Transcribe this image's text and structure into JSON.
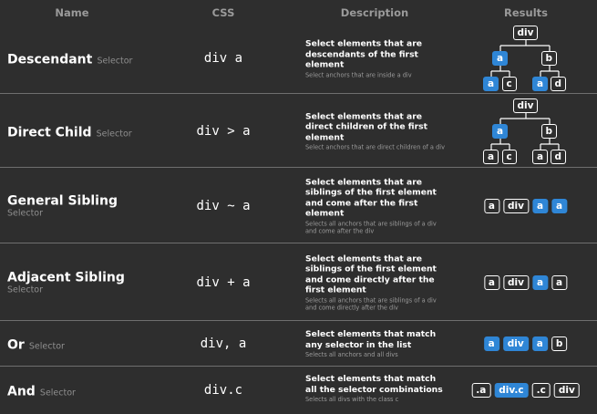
{
  "header": {
    "name": "Name",
    "css": "CSS",
    "description": "Description",
    "results": "Results"
  },
  "colors": {
    "background": "#2e2e2e",
    "highlight": "#2f86d6",
    "divider": "#6f6f6f",
    "muted": "#9a9a9a"
  },
  "rows": [
    {
      "name": "Descendant",
      "suffix": "Selector",
      "css": "div a",
      "desc": "Select elements that are descendants of the first element",
      "note": "Select anchors that are inside a div",
      "tree": {
        "root": "div",
        "l1": [
          {
            "t": "a",
            "hl": true
          },
          {
            "t": "b",
            "hl": false
          }
        ],
        "l2": [
          {
            "t": "a",
            "hl": true
          },
          {
            "t": "c",
            "hl": false
          },
          {
            "t": "a",
            "hl": true
          },
          {
            "t": "d",
            "hl": false
          }
        ]
      }
    },
    {
      "name": "Direct Child",
      "suffix": "Selector",
      "css": "div > a",
      "desc": "Select elements that are direct children of the first element",
      "note": "Select anchors that are direct children of a div",
      "tree": {
        "root": "div",
        "l1": [
          {
            "t": "a",
            "hl": true
          },
          {
            "t": "b",
            "hl": false
          }
        ],
        "l2": [
          {
            "t": "a",
            "hl": false
          },
          {
            "t": "c",
            "hl": false
          },
          {
            "t": "a",
            "hl": false
          },
          {
            "t": "d",
            "hl": false
          }
        ]
      }
    },
    {
      "name": "General Sibling",
      "suffix": "Selector",
      "css": "div ~ a",
      "desc": "Select elements that are siblings of the first element and come after the first element",
      "note": "Selects all anchors that are siblings of a div and come after the div",
      "chips": [
        {
          "t": "a",
          "hl": false
        },
        {
          "t": "div",
          "hl": false
        },
        {
          "t": "a",
          "hl": true
        },
        {
          "t": "a",
          "hl": true
        }
      ]
    },
    {
      "name": "Adjacent Sibling",
      "suffix": "Selector",
      "css": "div + a",
      "desc": "Select elements that are siblings of the first element and come directly after the first element",
      "note": "Selects all anchors that are siblings of a div and come directly after the div",
      "chips": [
        {
          "t": "a",
          "hl": false
        },
        {
          "t": "div",
          "hl": false
        },
        {
          "t": "a",
          "hl": true
        },
        {
          "t": "a",
          "hl": false
        }
      ]
    },
    {
      "name": "Or",
      "suffix": "Selector",
      "css": "div, a",
      "desc": "Select elements that match any selector in the list",
      "note": "Selects all anchors and all divs",
      "chips": [
        {
          "t": "a",
          "hl": true
        },
        {
          "t": "div",
          "hl": true
        },
        {
          "t": "a",
          "hl": true
        },
        {
          "t": "b",
          "hl": false
        }
      ]
    },
    {
      "name": "And",
      "suffix": "Selector",
      "css": "div.c",
      "desc": "Select elements that match all the selector combinations",
      "note": "Selects all divs with the class c",
      "chips": [
        {
          "t": ".a",
          "hl": false
        },
        {
          "t": "div.c",
          "hl": true
        },
        {
          "t": ".c",
          "hl": false
        },
        {
          "t": "div",
          "hl": false
        }
      ]
    }
  ]
}
